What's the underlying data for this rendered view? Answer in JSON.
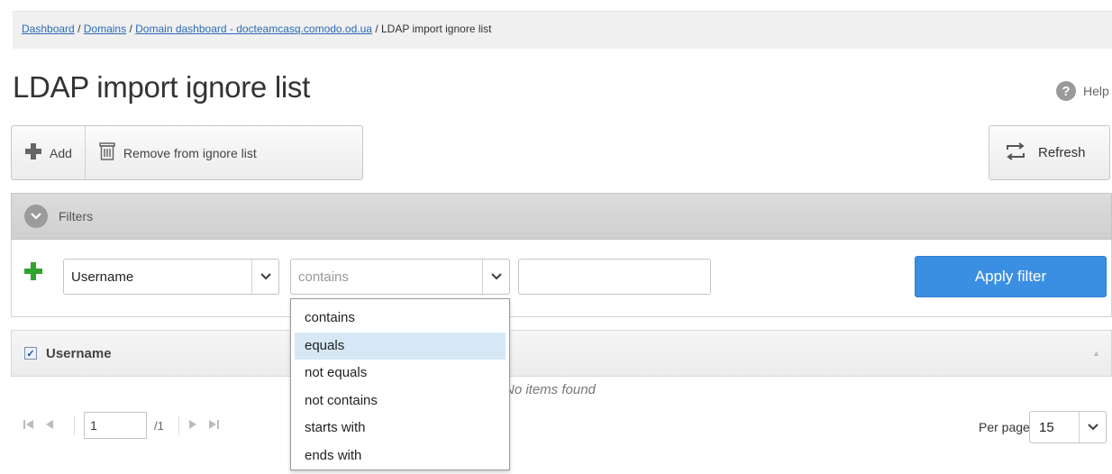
{
  "breadcrumb": {
    "items": [
      "Dashboard",
      "Domains",
      "Domain dashboard - docteamcasq.comodo.od.ua"
    ],
    "current": "LDAP import ignore list",
    "separator": "/"
  },
  "page": {
    "title": "LDAP import ignore list"
  },
  "help": {
    "label": "Help",
    "icon": "question-icon"
  },
  "toolbar": {
    "add_label": "Add",
    "remove_label": "Remove from ignore list",
    "refresh_label": "Refresh"
  },
  "filters": {
    "header": "Filters",
    "field_select": {
      "value": "Username"
    },
    "operator_select": {
      "value": "contains",
      "options": [
        "contains",
        "equals",
        "not equals",
        "not contains",
        "starts with",
        "ends with"
      ],
      "highlighted": "equals"
    },
    "value_input": "",
    "apply_label": "Apply filter"
  },
  "grid": {
    "columns": [
      "Username"
    ],
    "empty_text": "No items found"
  },
  "pager": {
    "page": "1",
    "total": "/1",
    "per_page_label": "Per page",
    "per_page": "15"
  },
  "colors": {
    "accent": "#3b8fe3",
    "add_green": "#2fa52f",
    "link": "#2a6bb8",
    "dropdown_highlight": "#d6e8f6"
  }
}
